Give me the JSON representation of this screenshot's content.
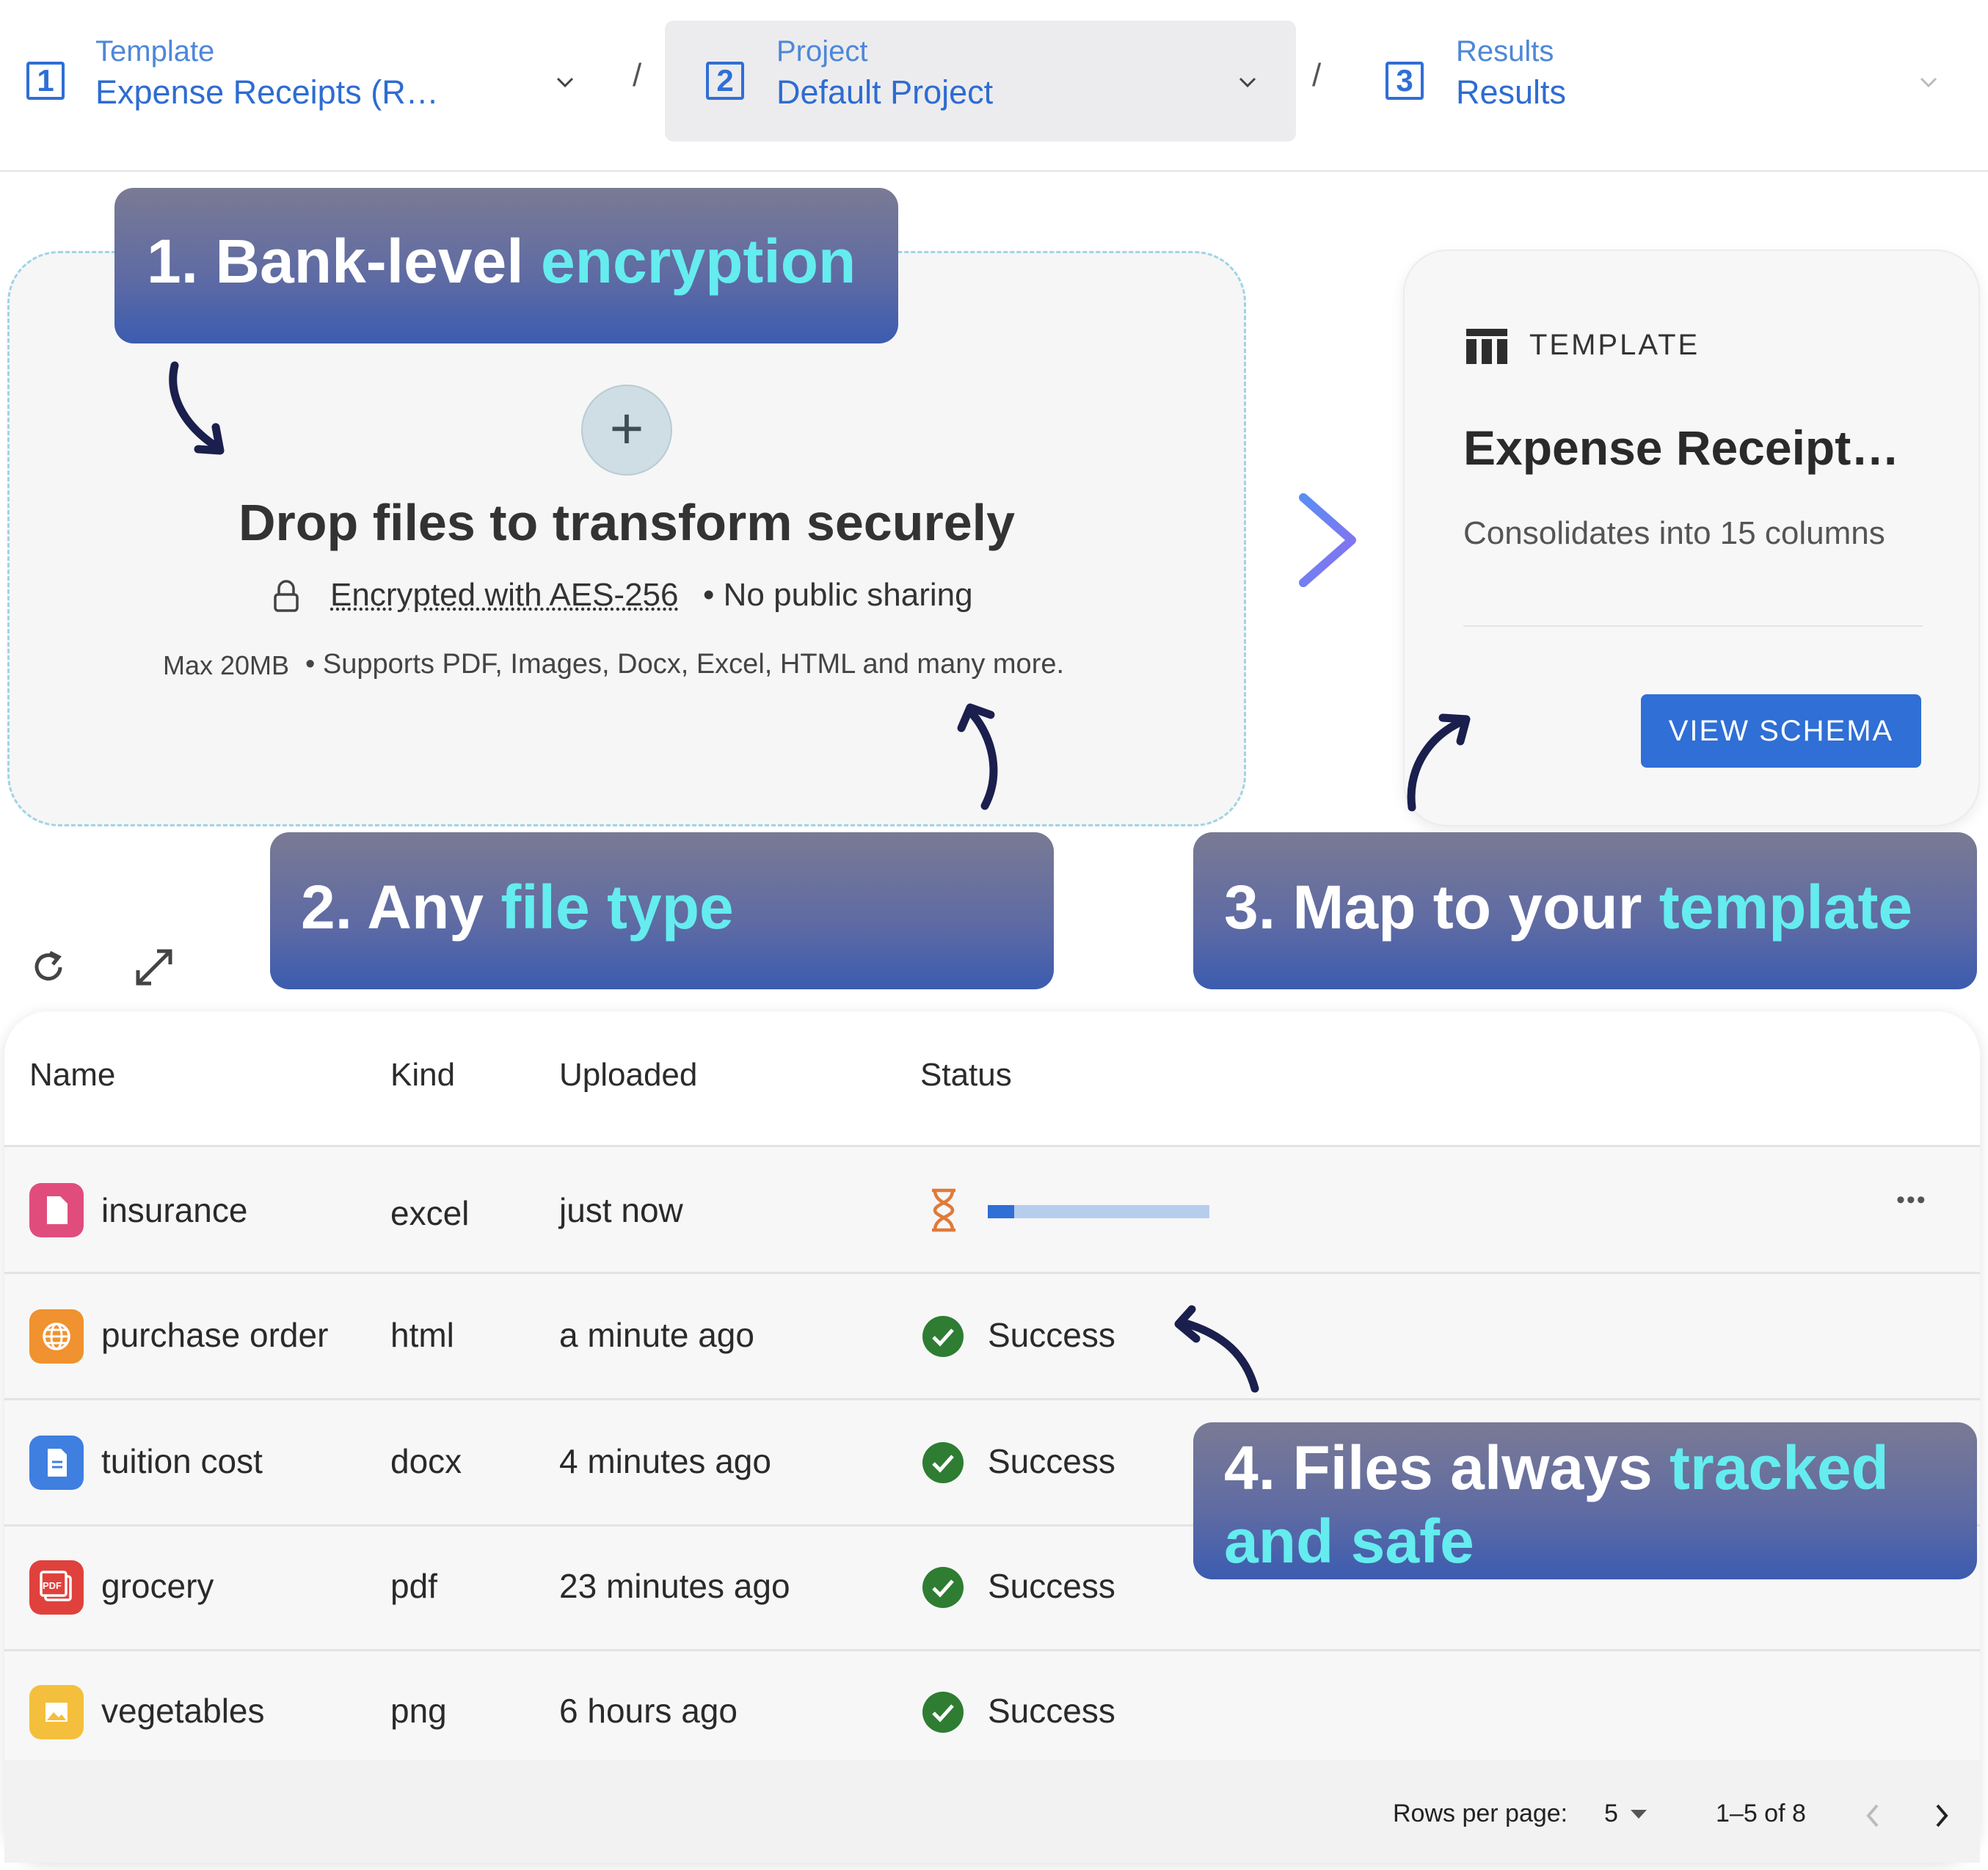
{
  "breadcrumb": {
    "steps": [
      {
        "number": "1",
        "label": "Template",
        "value": "Expense Receipts (R…"
      },
      {
        "number": "2",
        "label": "Project",
        "value": "Default Project"
      },
      {
        "number": "3",
        "label": "Results",
        "value": "Results"
      }
    ],
    "separator": "/"
  },
  "callouts": {
    "c1": {
      "plain": "1. Bank-level ",
      "highlight": "encryption"
    },
    "c2": {
      "plain": "2. Any ",
      "highlight": "file type"
    },
    "c3": {
      "plain": "3. Map to your ",
      "highlight": "template"
    },
    "c4": {
      "plain": "4. Files always ",
      "highlight": "tracked",
      "line2": "and safe"
    }
  },
  "dropzone": {
    "plus": "+",
    "title": "Drop files to transform securely",
    "encryption_link": "Encrypted with AES-256",
    "encryption_suffix": "• No public sharing",
    "max": "Max 20MB",
    "supports": "• Supports PDF, Images, Docx, Excel, HTML and many more."
  },
  "template_card": {
    "kicker": "TEMPLATE",
    "name": "Expense Receipt…",
    "description": "Consolidates into 15 columns",
    "button": "VIEW SCHEMA"
  },
  "table": {
    "columns": [
      "Name",
      "Kind",
      "Uploaded",
      "Status"
    ],
    "rows": [
      {
        "name": "insurance",
        "kind": "excel",
        "uploaded": "just now",
        "status": "",
        "progress": 0.12,
        "icon": "document-icon",
        "color": "#e04d7c"
      },
      {
        "name": "purchase order",
        "kind": "html",
        "uploaded": "a minute ago",
        "status": "Success",
        "icon": "globe-icon",
        "color": "#f0922f"
      },
      {
        "name": "tuition cost",
        "kind": "docx",
        "uploaded": "4 minutes ago",
        "status": "Success",
        "icon": "doc-icon",
        "color": "#3e7fe0"
      },
      {
        "name": "grocery",
        "kind": "pdf",
        "uploaded": "23 minutes ago",
        "status": "Success",
        "icon": "pdf-icon",
        "color": "#e0413c"
      },
      {
        "name": "vegetables",
        "kind": "png",
        "uploaded": "6 hours ago",
        "status": "Success",
        "icon": "image-icon",
        "color": "#f3bf3c"
      }
    ],
    "pdf_badge": "PDF",
    "more": "•••",
    "pagination": {
      "rows_label": "Rows per page:",
      "rows_value": "5",
      "range": "1–5 of 8"
    }
  },
  "colors": {
    "accent": "#2f6fd6",
    "highlight": "#65ecef",
    "success": "#2e7d32",
    "pending": "#e07a3a"
  }
}
